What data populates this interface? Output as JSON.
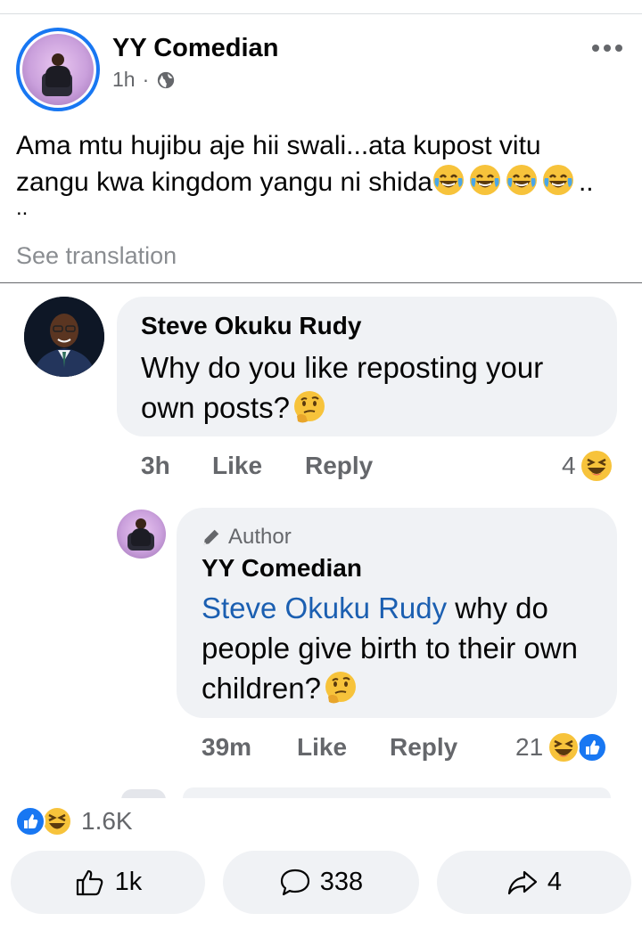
{
  "post": {
    "author": "YY Comedian",
    "time": "1h",
    "dot": "·",
    "privacy_icon": "globe-icon",
    "text_line1": "Ama mtu hujibu aje hii swali...ata kupost vitu",
    "text_line2": "zangu kwa kingdom yangu ni shida",
    "text_line2_end": "..",
    "text_tail": "..",
    "inline_emojis": [
      "joy-emoji",
      "joy-emoji",
      "joy-emoji",
      "joy-emoji"
    ],
    "see_translation": "See translation"
  },
  "comment": {
    "author": "Steve Okuku Rudy",
    "text": "Why do you like reposting your own posts?",
    "time": "3h",
    "like_label": "Like",
    "reply_label": "Reply",
    "reaction_count": "4",
    "reaction_icons": [
      "laughing-emoji"
    ]
  },
  "reply": {
    "badge": "Author",
    "author": "YY Comedian",
    "mention": "Steve Okuku Rudy",
    "text": " why do people give birth to their own children?",
    "time": "39m",
    "like_label": "Like",
    "reply_label": "Reply",
    "reaction_count": "21",
    "reaction_icons": [
      "laughing-emoji",
      "like-icon"
    ]
  },
  "footer": {
    "total_reactions": "1.6K",
    "like_count": "1k",
    "comment_count": "338",
    "share_count": "4"
  },
  "colors": {
    "accent": "#1877f2",
    "mention": "#1b5fb1",
    "secondary_text": "#65676b",
    "bubble": "#f0f2f5"
  }
}
